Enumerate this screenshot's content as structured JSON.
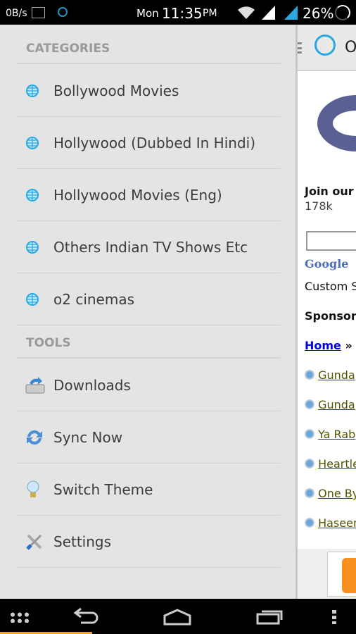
{
  "status": {
    "net_speed": "0B/s",
    "day": "Mon",
    "time": "11:35",
    "ampm": "PM",
    "battery": "26%"
  },
  "drawer": {
    "categories_header": "CATEGORIES",
    "categories": [
      {
        "label": "Bollywood Movies",
        "icon": "globe-icon"
      },
      {
        "label": "Hollywood (Dubbed In Hindi)",
        "icon": "globe-icon"
      },
      {
        "label": "Hollywood Movies (Eng)",
        "icon": "globe-icon"
      },
      {
        "label": "Others Indian TV Shows Etc",
        "icon": "globe-icon"
      },
      {
        "label": "o2 cinemas",
        "icon": "globe-icon"
      }
    ],
    "tools_header": "TOOLS",
    "tools": [
      {
        "label": "Downloads",
        "icon": "download-icon"
      },
      {
        "label": "Sync Now",
        "icon": "sync-icon"
      },
      {
        "label": "Switch Theme",
        "icon": "lightbulb-icon"
      },
      {
        "label": "Settings",
        "icon": "settings-icon"
      }
    ]
  },
  "page": {
    "title": "O",
    "join": "Join our ",
    "count": "178k",
    "custom": "Custom S",
    "sponsored": "Sponsore",
    "home": "Home",
    "sep": " » B",
    "links": [
      "Gunda",
      "Gunda",
      "Ya Rab",
      "Heartle",
      "One By",
      "Haseen"
    ]
  },
  "colors": {
    "accent": "#f0a030",
    "globe": "#29a8e0"
  }
}
